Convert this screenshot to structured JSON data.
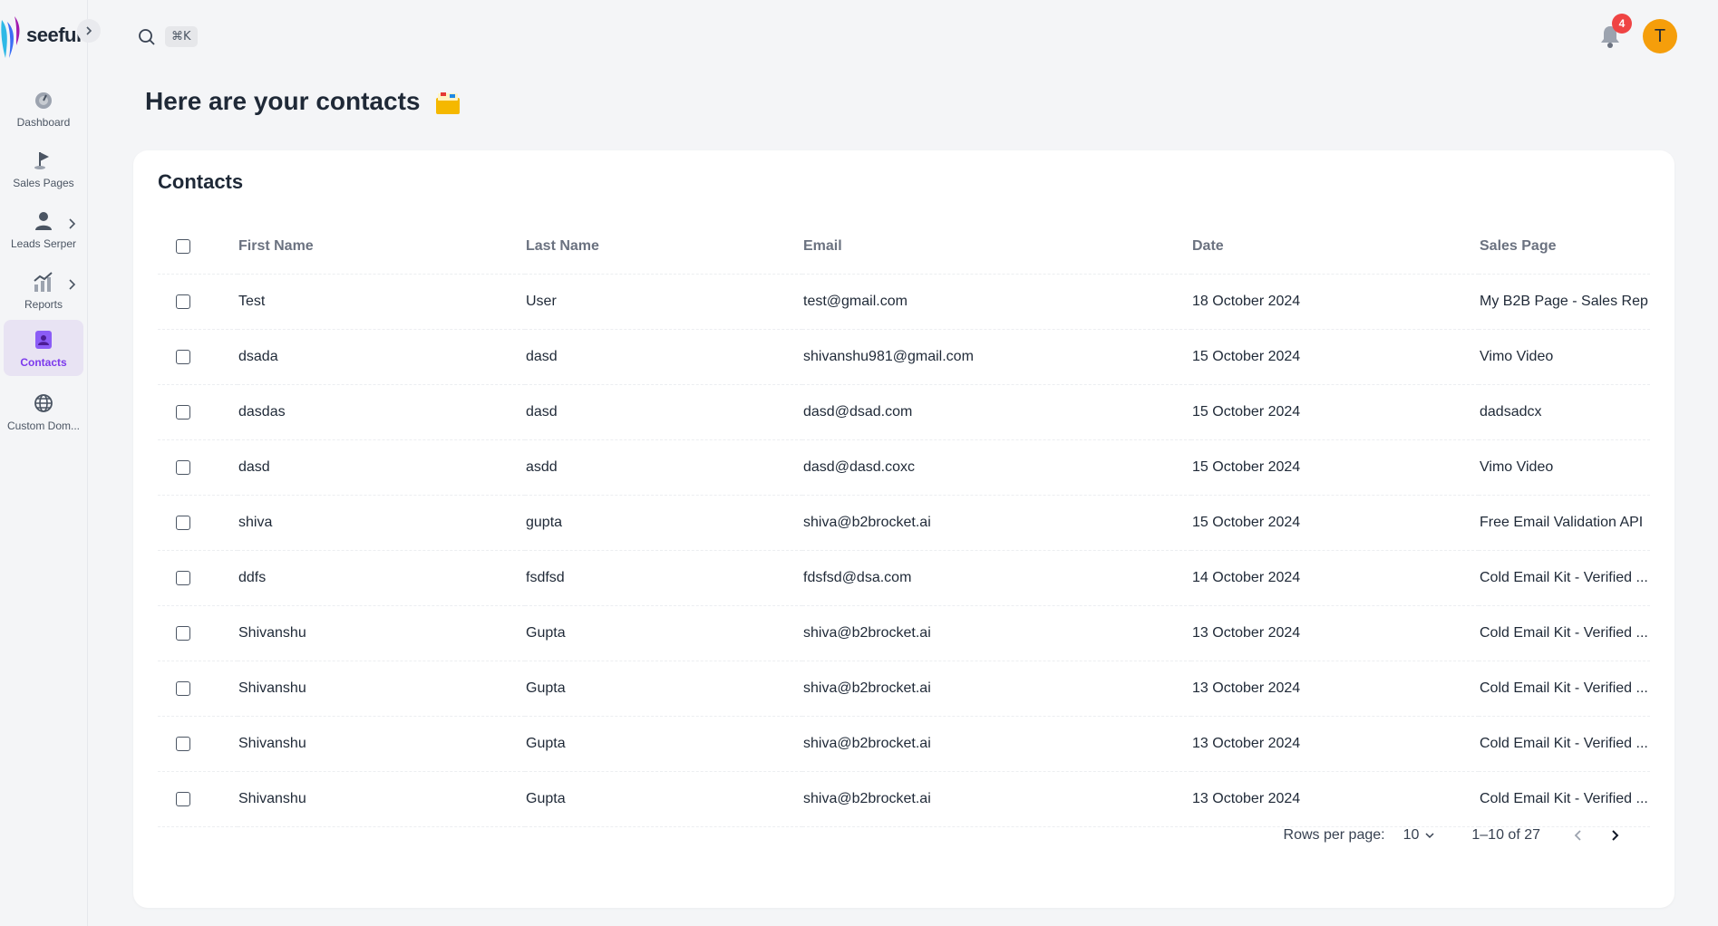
{
  "app": {
    "brand": "seefunnel",
    "colors": {
      "accent": "#7c3aed",
      "active_bg": "#e8e3f3",
      "badge": "#ef4444",
      "avatar": "#f59e0b"
    }
  },
  "sidebar": {
    "items": [
      {
        "label": "Dashboard",
        "icon": "dashboard-gauge-icon"
      },
      {
        "label": "Sales Pages",
        "icon": "flag-icon"
      },
      {
        "label": "Leads Serper",
        "icon": "user-icon"
      },
      {
        "label": "Reports",
        "icon": "chart-icon"
      },
      {
        "label": "Contacts",
        "icon": "contact-card-icon",
        "active": true
      },
      {
        "label": "Custom Dom...",
        "icon": "globe-icon"
      }
    ]
  },
  "topbar": {
    "shortcut": "⌘K",
    "notifications_count": "4",
    "avatar_initial": "T"
  },
  "page": {
    "title": "Here are your contacts"
  },
  "contacts": {
    "title": "Contacts",
    "columns": [
      "First Name",
      "Last Name",
      "Email",
      "Date",
      "Sales Page"
    ],
    "rows": [
      [
        "Test",
        "User",
        "test@gmail.com",
        "18 October 2024",
        "My B2B Page - Sales Rep"
      ],
      [
        "dsada",
        "dasd",
        "shivanshu981@gmail.com",
        "15 October 2024",
        "Vimo Video"
      ],
      [
        "dasdas",
        "dasd",
        "dasd@dsad.com",
        "15 October 2024",
        "dadsadcx"
      ],
      [
        "dasd",
        "asdd",
        "dasd@dasd.coxc",
        "15 October 2024",
        "Vimo Video"
      ],
      [
        "shiva",
        "gupta",
        "shiva@b2brocket.ai",
        "15 October 2024",
        "Free Email Validation API"
      ],
      [
        "ddfs",
        "fsdfsd",
        "fdsfsd@dsa.com",
        "14 October 2024",
        "Cold Email Kit - Verified ..."
      ],
      [
        "Shivanshu",
        "Gupta",
        "shiva@b2brocket.ai",
        "13 October 2024",
        "Cold Email Kit - Verified ..."
      ],
      [
        "Shivanshu",
        "Gupta",
        "shiva@b2brocket.ai",
        "13 October 2024",
        "Cold Email Kit - Verified ..."
      ],
      [
        "Shivanshu",
        "Gupta",
        "shiva@b2brocket.ai",
        "13 October 2024",
        "Cold Email Kit - Verified ..."
      ],
      [
        "Shivanshu",
        "Gupta",
        "shiva@b2brocket.ai",
        "13 October 2024",
        "Cold Email Kit - Verified ..."
      ]
    ],
    "pagination": {
      "rows_per_page_label": "Rows per page:",
      "rows_per_page": "10",
      "range": "1–10 of 27"
    }
  }
}
